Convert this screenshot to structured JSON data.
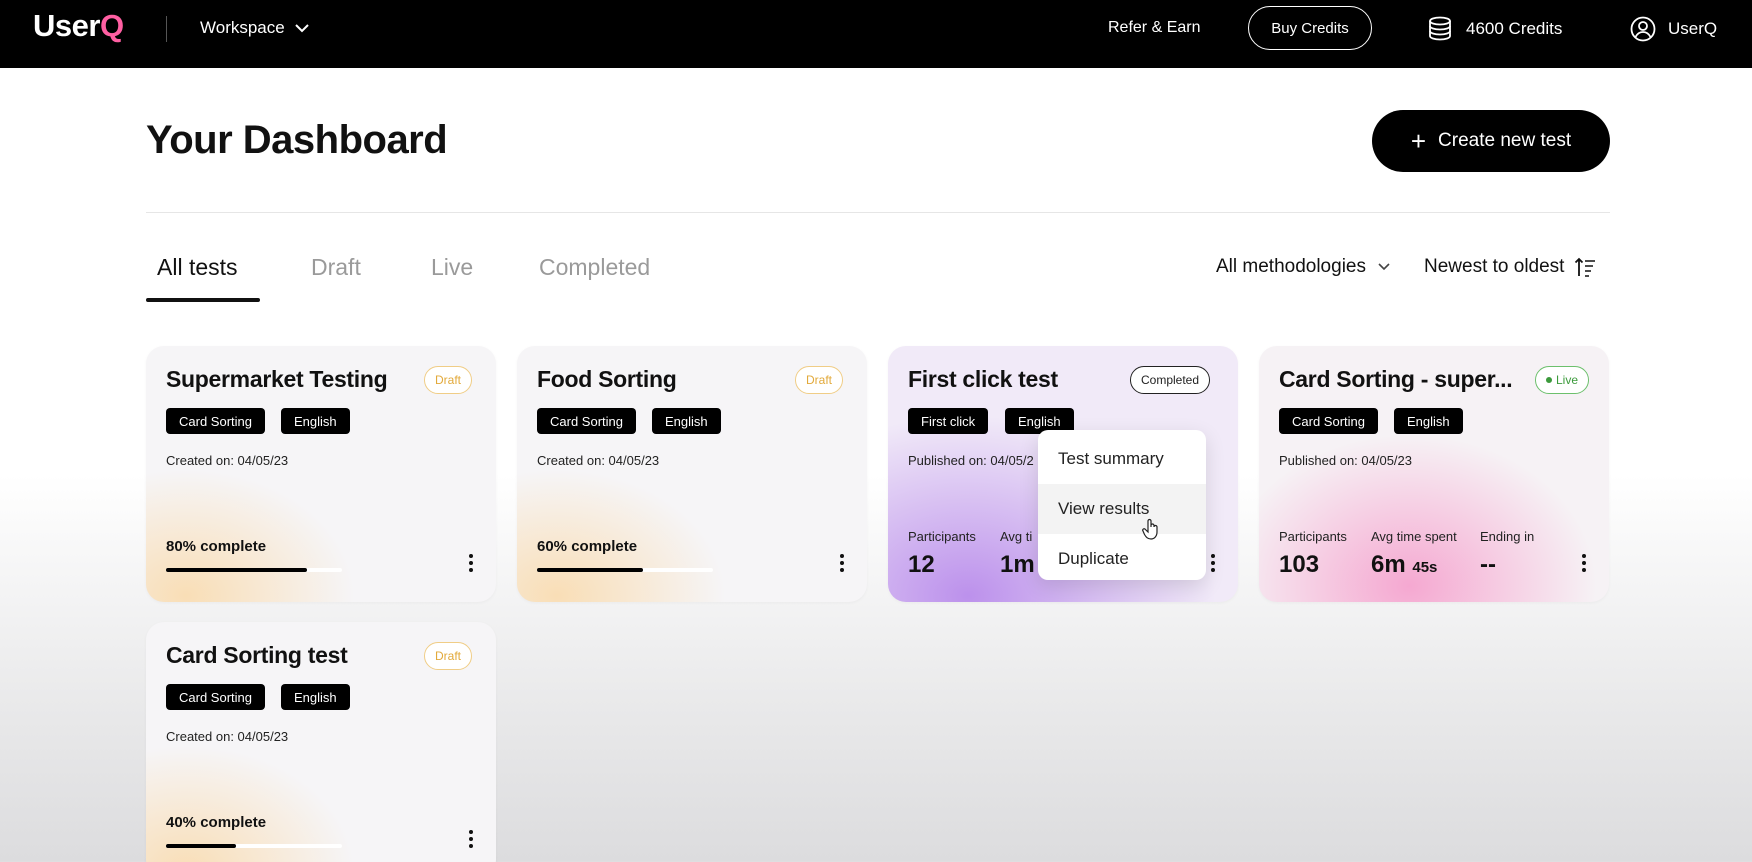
{
  "topbar": {
    "logo_text": "User",
    "logo_accent": "Q",
    "workspace_label": "Workspace",
    "refer_label": "Refer & Earn",
    "buy_credits_label": "Buy Credits",
    "credits_label": "4600 Credits",
    "account_label": "UserQ",
    "brand_accent_color": "#ff5fa2"
  },
  "header": {
    "title": "Your Dashboard",
    "create_button_label": "Create new test"
  },
  "tabs": [
    {
      "label": "All tests",
      "active": true
    },
    {
      "label": "Draft",
      "active": false
    },
    {
      "label": "Live",
      "active": false
    },
    {
      "label": "Completed",
      "active": false
    }
  ],
  "filters": {
    "methodology_label": "All methodologies",
    "sort_label": "Newest to oldest"
  },
  "cards": [
    {
      "title": "Supermarket Testing",
      "status": "Draft",
      "tags": [
        "Card Sorting",
        "English"
      ],
      "meta": "Created on: 04/05/23",
      "progress_label": "80% complete",
      "progress": 0.8
    },
    {
      "title": "Food Sorting",
      "status": "Draft",
      "tags": [
        "Card Sorting",
        "English"
      ],
      "meta": "Created on: 04/05/23",
      "progress_label": "60% complete",
      "progress": 0.6
    },
    {
      "title": "First click test",
      "status": "Completed",
      "tags": [
        "First click",
        "English"
      ],
      "meta": "Published on: 04/05/2",
      "stats": [
        {
          "label": "Participants",
          "value": "12"
        },
        {
          "label": "Avg ti",
          "value": "1m"
        }
      ]
    },
    {
      "title": "Card Sorting - super...",
      "status": "Live",
      "tags": [
        "Card Sorting",
        "English"
      ],
      "meta": "Published on: 04/05/23",
      "stats": [
        {
          "label": "Participants",
          "value": "103"
        },
        {
          "label": "Avg time spent",
          "value": "6m",
          "value_small": "45s"
        },
        {
          "label": "Ending in",
          "value": "--"
        }
      ]
    },
    {
      "title": "Card Sorting test",
      "status": "Draft",
      "tags": [
        "Card Sorting",
        "English"
      ],
      "meta": "Created on: 04/05/23",
      "progress_label": "40% complete",
      "progress": 0.4
    }
  ],
  "context_menu": {
    "items": [
      "Test summary",
      "View results",
      "Duplicate"
    ],
    "hovered": "View results"
  },
  "icons": {
    "workspace_chevron": "chevron-down-icon",
    "credits": "coin-stack-icon",
    "account": "user-circle-icon",
    "create": "plus-icon",
    "methodology_chevron": "chevron-down-icon",
    "sort": "sort-icon",
    "card_menu": "kebab-menu-icon",
    "cursor": "hand-pointer-icon"
  },
  "colors": {
    "draft_badge": "#e2a93a",
    "live_badge": "#3b9a3b",
    "completed_glow": "#b98ceb",
    "live_glow": "#f5a0cd",
    "draft_glow": "#fad6a0"
  }
}
